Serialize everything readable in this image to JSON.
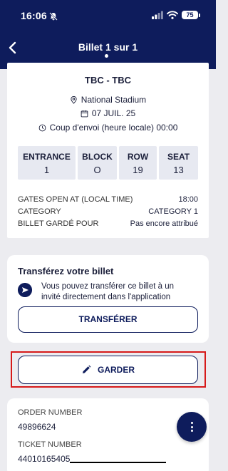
{
  "status_bar": {
    "time": "16:06",
    "battery": "75"
  },
  "header": {
    "title": "Billet 1 sur 1"
  },
  "ticket": {
    "match": "TBC - TBC",
    "stadium": "National Stadium",
    "date": "07 JUIL. 25",
    "kickoff": "Coup d'envoi (heure locale) 00:00",
    "seat_info": [
      {
        "label": "ENTRANCE",
        "value": "1"
      },
      {
        "label": "BLOCK",
        "value": "O"
      },
      {
        "label": "ROW",
        "value": "19"
      },
      {
        "label": "SEAT",
        "value": "13"
      }
    ],
    "details": [
      {
        "key": "GATES OPEN AT (LOCAL TIME)",
        "value": "18:00"
      },
      {
        "key": "CATEGORY",
        "value": "CATEGORY 1"
      },
      {
        "key": "BILLET GARDÉ POUR",
        "value": "Pas encore attribué"
      }
    ]
  },
  "transfer": {
    "title": "Transférez votre billet",
    "description": "Vous pouvez transférer ce billet à un invité directement dans l'application",
    "button_label": "TRANSFÉRER"
  },
  "keep": {
    "button_label": "GARDER"
  },
  "order": {
    "order_number_label": "ORDER NUMBER",
    "order_number": "49896624",
    "ticket_number_label": "TICKET NUMBER",
    "ticket_number": "44010165405"
  },
  "colors": {
    "primary": "#0e1c5c",
    "highlight": "#d61a1a",
    "background": "#ececf0"
  }
}
